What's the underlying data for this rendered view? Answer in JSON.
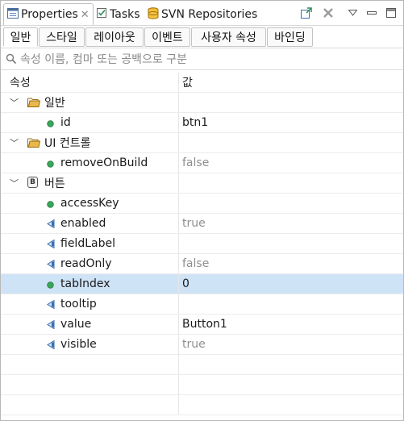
{
  "view_tabs": [
    {
      "label": "Properties",
      "icon": "properties-icon"
    },
    {
      "label": "Tasks",
      "icon": "tasks-icon"
    },
    {
      "label": "SVN Repositories",
      "icon": "svn-icon"
    }
  ],
  "category_tabs": [
    "일반",
    "스타일",
    "레이아웃",
    "이벤트",
    "사용자 속성",
    "바인딩"
  ],
  "search": {
    "placeholder": "속성 이름, 컴마 또는 공백으로 구분"
  },
  "columns": {
    "property": "속성",
    "value": "값"
  },
  "groups": [
    {
      "label": "일반",
      "icon": "folder-icon",
      "items": [
        {
          "name": "id",
          "value": "btn1",
          "icon": "green-dot-icon",
          "gray": false
        }
      ]
    },
    {
      "label": "UI 컨트롤",
      "icon": "folder-icon",
      "items": [
        {
          "name": "removeOnBuild",
          "value": "false",
          "icon": "green-dot-icon",
          "gray": true
        }
      ]
    },
    {
      "label": "버튼",
      "icon": "button-b-icon",
      "items": [
        {
          "name": "accessKey",
          "value": "",
          "icon": "green-dot-icon",
          "gray": false
        },
        {
          "name": "enabled",
          "value": "true",
          "icon": "blue-arrow-icon",
          "gray": true
        },
        {
          "name": "fieldLabel",
          "value": "",
          "icon": "blue-arrow-icon",
          "gray": false
        },
        {
          "name": "readOnly",
          "value": "false",
          "icon": "blue-arrow-icon",
          "gray": true
        },
        {
          "name": "tabIndex",
          "value": "0",
          "icon": "green-dot-icon",
          "gray": false,
          "selected": true
        },
        {
          "name": "tooltip",
          "value": "",
          "icon": "blue-arrow-icon",
          "gray": false
        },
        {
          "name": "value",
          "value": "Button1",
          "icon": "blue-arrow-icon",
          "gray": false
        },
        {
          "name": "visible",
          "value": "true",
          "icon": "blue-arrow-icon",
          "gray": true
        }
      ]
    }
  ],
  "colors": {
    "selection": "#cfe3f7",
    "folder": "#e8b84a",
    "green_dot": "#3aa65a",
    "blue_arrow": "#3a6fb0"
  }
}
